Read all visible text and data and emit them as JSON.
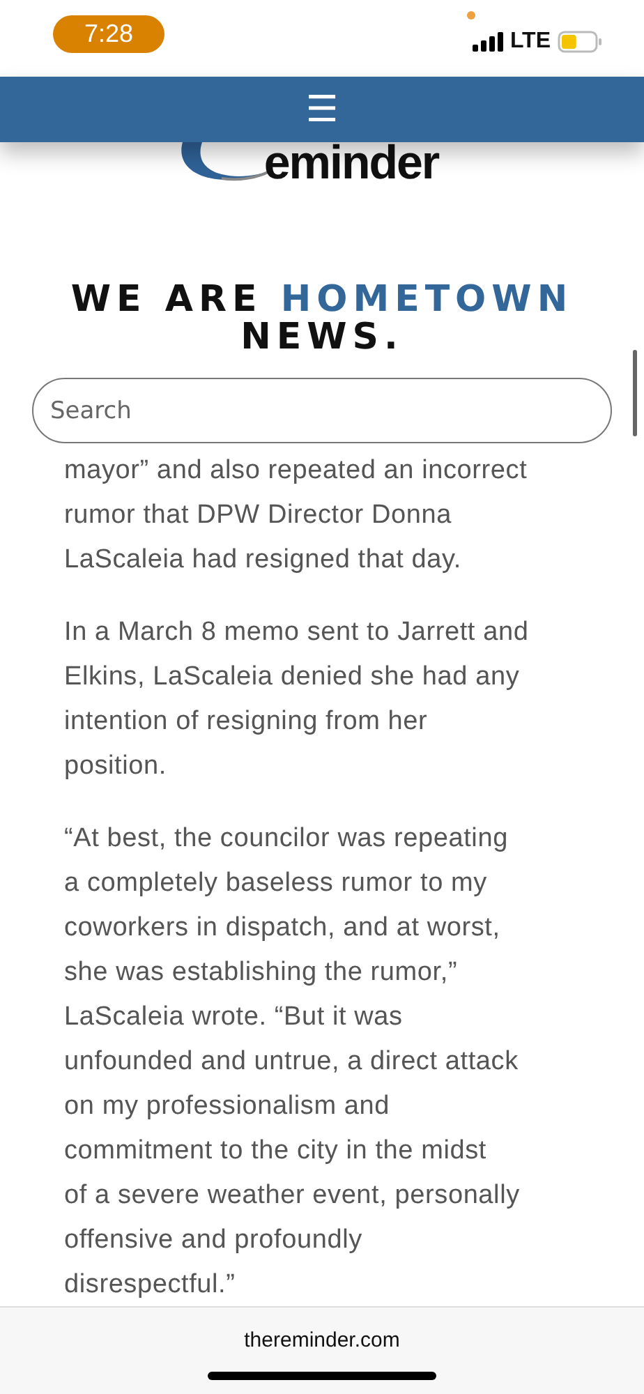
{
  "status_bar": {
    "time": "7:28",
    "network": "LTE",
    "battery": {
      "level": 0.45
    }
  },
  "header": {
    "menu_icon": "☰"
  },
  "logo": {
    "text": "eminder"
  },
  "tagline": {
    "plain": "WE ARE",
    "accent": "HOMETOWN",
    "rest": "NEWS."
  },
  "search": {
    "placeholder": "Search"
  },
  "paragraphs": [
    {
      "lines": [
        "mayor” and also repeated an incorrect",
        "rumor that DPW Director Donna",
        "LaScaleia had resigned that day."
      ]
    },
    {
      "lines": [
        "In a March 8 memo sent to Jarrett and",
        "Elkins, LaScaleia denied she had any",
        "intention of resigning from her",
        "position."
      ]
    },
    {
      "lines": [
        "“At best, the councilor was repeating",
        "a completely baseless rumor to my",
        "coworkers in dispatch, and at worst,",
        "she was establishing the rumor,”",
        "LaScaleia wrote. “But it was",
        "unfounded and untrue, a direct attack",
        "on my professionalism and",
        "commitment to the city in the midst",
        "of a severe weather event, personally",
        "offensive and profoundly",
        "disrespectful.”"
      ]
    }
  ],
  "address_bar": {
    "url": "thereminder.com"
  }
}
